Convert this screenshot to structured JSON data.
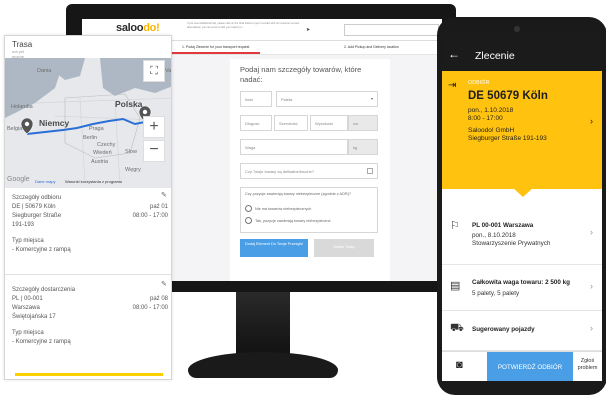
{
  "website": {
    "logo_text": "saloo",
    "logo_suffix": "do!",
    "top_note": "If you need additional help, please click on the Chat button to get in contact with our customer service. Alternatively, you can send us with your inquiry to ...",
    "step1_label": "1. Podaj Zlecenie for your transport request",
    "step2_label": "2. Add Pickup and Delivery location",
    "form": {
      "title": "Podaj nam szczegóły towarów, które nadać:",
      "qty_label": "Ilość",
      "pallet_label": "Paleta",
      "length_label": "Długość",
      "width_label": "Szerokość",
      "height_label": "Wysokość",
      "unit_cm": "cm",
      "weight_label": "Waga",
      "unit_kg": "kg",
      "fragile_question": "Czy Twoje towary są delikatne/kruche?",
      "adr_question": "Czy pozycje zawierają towary niebezpieczne (zgodnie z ADR)?",
      "adr_no": "Nie ma towarów niebezpiecznych",
      "adr_yes": "Tak, pozycje zawierają towary niebezpieczne",
      "add_button": "Dodaj Element Do Twoje Przesyłki",
      "quote_button": "Ustaw Trasę"
    }
  },
  "left_panel": {
    "title": "Trasa",
    "subtitle_line1": "not yet",
    "subtitle_line2": "mocne",
    "map": {
      "labels": {
        "dania": "Dania",
        "holandia": "Holandia",
        "polska": "Polska",
        "belgia": "Belgia",
        "niemcy": "Niemcy",
        "praga": "Praga",
        "berlin": "Berlin",
        "czechy": "Czechy",
        "wieden": "Wiedeń",
        "slow": "Słow",
        "austria": "Austria",
        "wegry": "Węgry",
        "edge": "Va"
      },
      "google": "Google",
      "dane_mapy": "Dane mapy",
      "terms": "Warunki korzystania z programu"
    },
    "pickup": {
      "heading": "Szczegóły odbioru",
      "line1": "DE | 50679 Köln",
      "line1_right": "paź 01",
      "line2": "Siegburger Straße",
      "line2_right": "08:00 - 17:00",
      "line3": "191-193",
      "type_heading": "Typ miejsca",
      "type_value": "- Komercyjne z rampą"
    },
    "delivery": {
      "heading": "Szczegóły dostarczenia",
      "line1": "PL | 00-001",
      "line1_right": "paź 08",
      "line2": "Warszawa",
      "line2_right": "08:00 - 17:00",
      "line3": "Świętojańska 17",
      "type_heading": "Typ miejsca",
      "type_value": "- Komercyjne z rampą"
    }
  },
  "phone": {
    "title": "Zlecenie",
    "pickup": {
      "label": "ODBIÓR",
      "city": "DE 50679 Köln",
      "date": "pon., 1.10.2018",
      "time": "8:00 - 17:00",
      "company": "Saloodo! GmbH",
      "street": "Siegburger Straße 191-193"
    },
    "delivery": {
      "city": "PL 00-001 Warszawa",
      "date": "pon., 8.10.2018",
      "org": "Stowarzyszenie Prywatnych"
    },
    "weight": {
      "title": "Całkowita waga towaru: 2 500 kg",
      "sub": "5 palety, 5 palety"
    },
    "vehicle": "Sugerowany pojazdy",
    "confirm_button": "POTWIERDŹ ODBIÓR",
    "report_line1": "Zgłoś",
    "report_line2": "problem"
  },
  "colors": {
    "accent_yellow": "#ffc20e",
    "button_blue": "#4a9ee6",
    "route_blue": "#2a6fd6",
    "step_red": "#e0383b"
  }
}
